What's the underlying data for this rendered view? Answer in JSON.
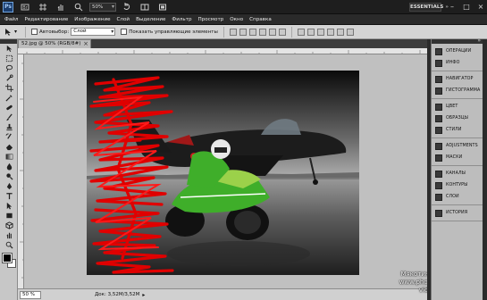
{
  "app": {
    "logo": "Ps",
    "zoom": "50%",
    "workspace": "ESSENTIALS",
    "window_controls": [
      "–",
      "□",
      "×"
    ]
  },
  "menu": [
    "Файл",
    "Редактирование",
    "Изображение",
    "Слой",
    "Выделение",
    "Фильтр",
    "Просмотр",
    "Окно",
    "Справка"
  ],
  "options": {
    "autoselect_label": "Автовыбор:",
    "autoselect_value": "Слой",
    "show_controls_label": "Показать управляющие элементы"
  },
  "document": {
    "tab_title": "52.jpg @ 50% (RGB/8#)",
    "status_zoom": "50 %",
    "status_doc": "Док: 3,52M/3,52M"
  },
  "watermark": {
    "line1": "Мякотин Антон",
    "line2": "www.photoshop-video.com"
  },
  "panels": {
    "group1": [
      "ОПЕРАЦИИ",
      "ИНФО"
    ],
    "group2": [
      "НАВИГАТОР",
      "ГИСТОГРАММА"
    ],
    "group3": [
      "ЦВЕТ",
      "ОБРАЗЦЫ",
      "СТИЛИ"
    ],
    "group4": [
      "ADJUSTMENTS",
      "МАСКИ"
    ],
    "group5": [
      "КАНАЛЫ",
      "КОНТУРЫ",
      "СЛОИ"
    ],
    "group6": [
      "ИСТОРИЯ"
    ]
  },
  "colors": {
    "foreground": "#000000",
    "background": "#ffffff",
    "scribble": "#e00000",
    "bike": "#3fae2a"
  },
  "tool_icons": [
    "move-icon",
    "marquee-icon",
    "lasso-icon",
    "quick-select-icon",
    "crop-icon",
    "eyedropper-icon",
    "healing-icon",
    "brush-icon",
    "clone-stamp-icon",
    "history-brush-icon",
    "eraser-icon",
    "gradient-icon",
    "blur-icon",
    "dodge-icon",
    "pen-icon",
    "type-icon",
    "path-select-icon",
    "shape-icon",
    "3d-icon",
    "hand-icon",
    "zoom-icon"
  ]
}
